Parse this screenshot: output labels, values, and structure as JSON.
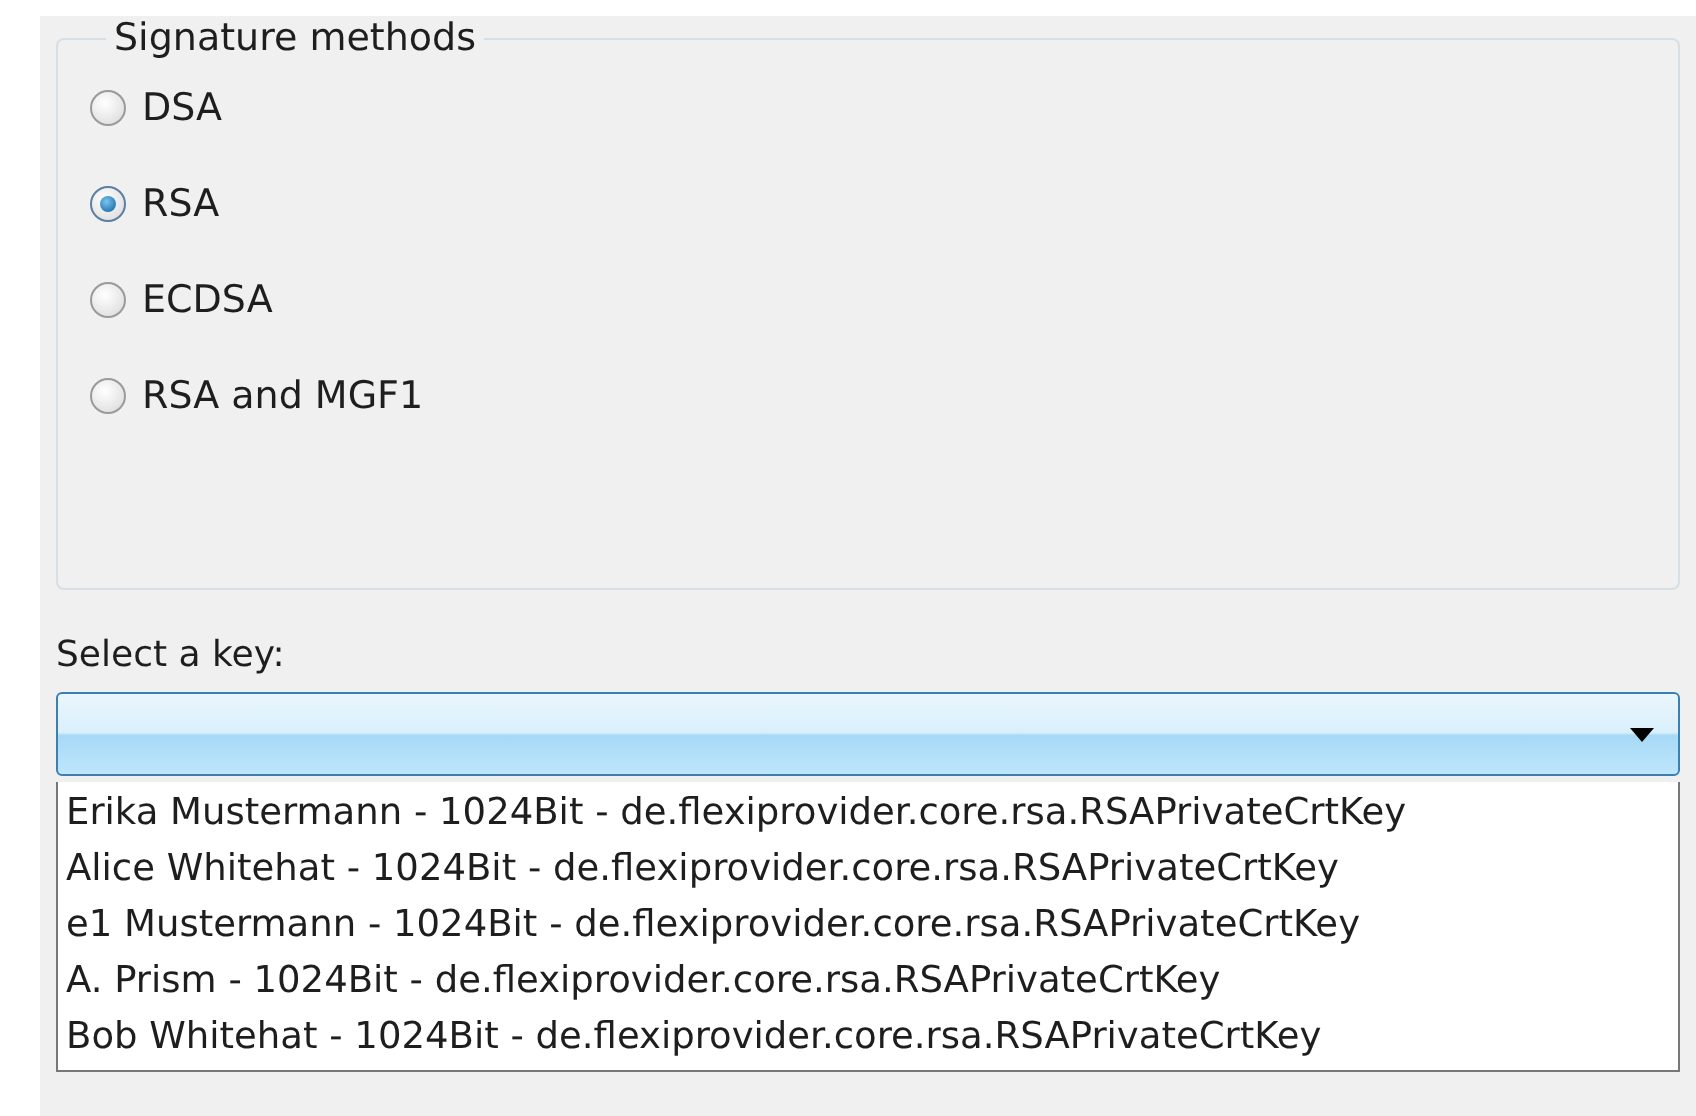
{
  "group": {
    "title": "Signature methods",
    "options": [
      {
        "label": "DSA",
        "selected": false
      },
      {
        "label": "RSA",
        "selected": true
      },
      {
        "label": "ECDSA",
        "selected": false
      },
      {
        "label": "RSA and MGF1",
        "selected": false
      }
    ]
  },
  "key_select": {
    "label": "Select a key:",
    "expanded": true,
    "items": [
      "Erika Mustermann - 1024Bit - de.flexiprovider.core.rsa.RSAPrivateCrtKey",
      "Alice Whitehat - 1024Bit - de.flexiprovider.core.rsa.RSAPrivateCrtKey",
      "e1 Mustermann - 1024Bit - de.flexiprovider.core.rsa.RSAPrivateCrtKey",
      "A. Prism - 1024Bit - de.flexiprovider.core.rsa.RSAPrivateCrtKey",
      "Bob Whitehat - 1024Bit - de.flexiprovider.core.rsa.RSAPrivateCrtKey"
    ]
  }
}
